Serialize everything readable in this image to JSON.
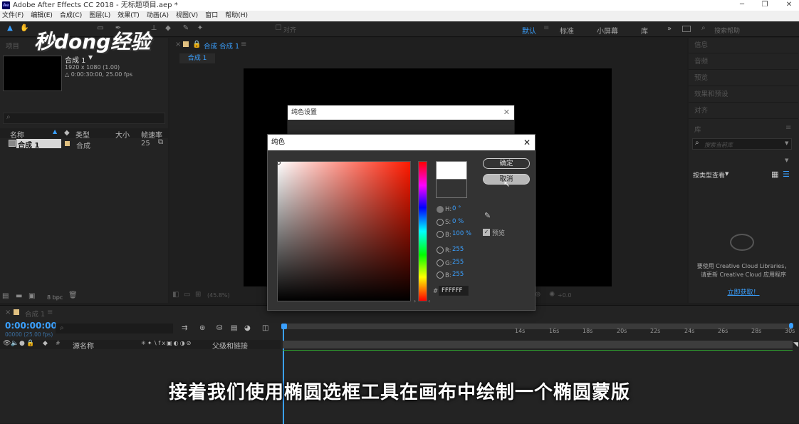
{
  "window": {
    "title": "Adobe After Effects CC 2018 - 无标题项目.aep *",
    "app_icon": "Ae"
  },
  "menu": [
    "文件(F)",
    "编辑(E)",
    "合成(C)",
    "图层(L)",
    "效果(T)",
    "动画(A)",
    "视图(V)",
    "窗口",
    "帮助(H)"
  ],
  "toolbar": {
    "align_label": "对齐"
  },
  "workspaces": [
    "默认",
    "标准",
    "小屏幕",
    "库"
  ],
  "search_help": "搜索帮助",
  "watermark": "秒dong经验",
  "project": {
    "tab": "项目",
    "comp_name": "合成 1",
    "comp_info": "1920 x 1080 (1.00)",
    "comp_duration": "△ 0:00:30:00, 25.00 fps",
    "columns": [
      "名称",
      "类型",
      "大小",
      "帧速率"
    ],
    "row": {
      "name": "合成 1",
      "type": "合成",
      "fps": "25"
    },
    "bpc": "8 bpc"
  },
  "composition": {
    "tab": "合成 合成 1",
    "sub_tab": "合成 1",
    "zoom": "(45.8%)",
    "exposure": "+0.0"
  },
  "right_panels": [
    "信息",
    "音频",
    "预览",
    "效果和预设",
    "对齐",
    "库"
  ],
  "library": {
    "search_placeholder": "搜索当前库",
    "view_label": "按类型查看",
    "message": "要使用 Creative Cloud Libraries，请更新 Creative Cloud 应用程序",
    "link": "立即获取！"
  },
  "bg_dialog": {
    "title": "纯色设置",
    "preview_label": "预览",
    "ok": "确定",
    "cancel": "取消"
  },
  "picker": {
    "title": "纯色",
    "ok": "确定",
    "cancel": "取消",
    "H": "0 °",
    "S": "0 %",
    "B": "100 %",
    "R": "255",
    "G": "255",
    "Bv": "255",
    "hex": "FFFFFF",
    "preview_label": "预览",
    "labels": {
      "h": "H:",
      "s": "S:",
      "b": "B:",
      "r": "R:",
      "g": "G:",
      "bb": "B:"
    },
    "hash": "#"
  },
  "timeline": {
    "tab": "合成 1",
    "time": "0:00:00:00",
    "frames": "00000 (25.00 fps)",
    "col_source": "源名称",
    "col_parent": "父级和链接",
    "ticks": [
      "14s",
      "16s",
      "18s",
      "20s",
      "22s",
      "24s",
      "26s",
      "28s",
      "30s"
    ]
  },
  "subtitle": "接着我们使用椭圆选框工具在画布中绘制一个椭圆蒙版",
  "colors": {
    "accent": "#3aa0ff",
    "selected_swatch": "#ffffff",
    "panel_bg": "#232323"
  }
}
